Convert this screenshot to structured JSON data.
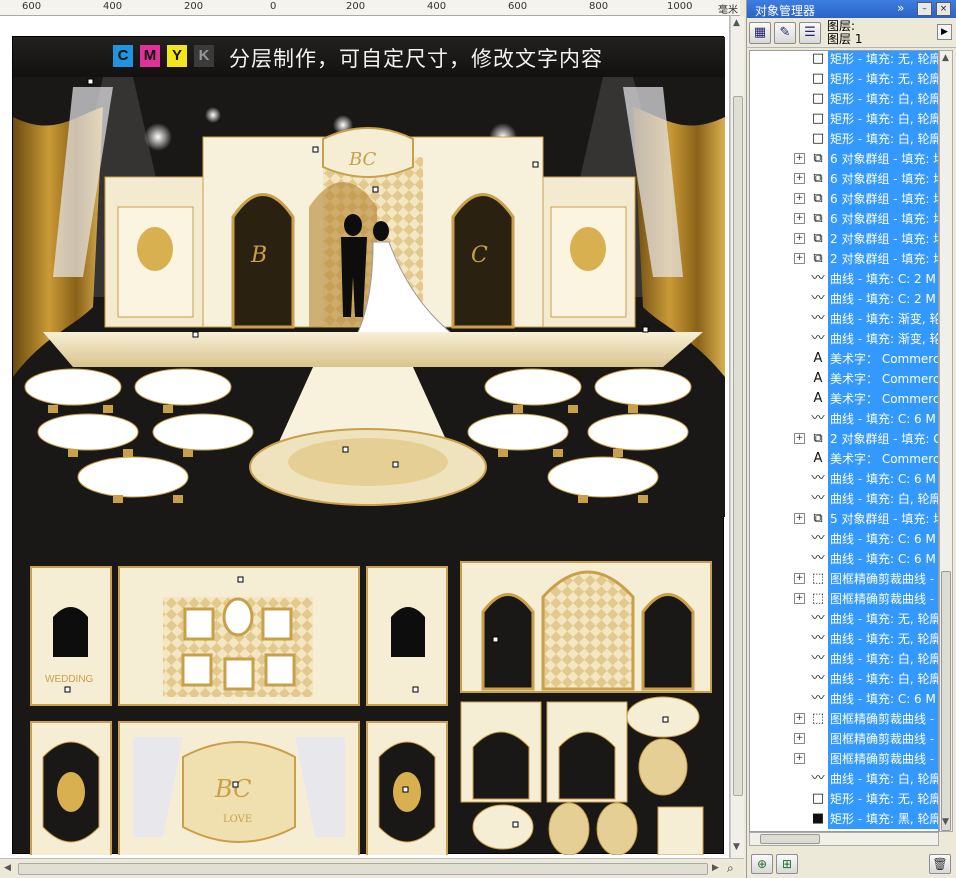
{
  "ruler": {
    "labels": [
      "600",
      "400",
      "200",
      "0",
      "200",
      "400",
      "600",
      "800",
      "1000"
    ],
    "unit": "毫米"
  },
  "canvas": {
    "cmyk_letters": [
      "C",
      "M",
      "Y",
      "K"
    ],
    "cmyk_colors": [
      "#1f95e0",
      "#e0309a",
      "#f2e51a",
      "#3a3a3a"
    ],
    "banner_title": "分层制作，可自定尺寸，修改文字内容",
    "monogram": "BC",
    "letter_left": "B",
    "letter_right": "C",
    "photo_wall_text": "WEDDING",
    "love_text": "LOVE",
    "accent_gold": "#c9a04a",
    "cream": "#f3ead0"
  },
  "panel": {
    "title": "对象管理器",
    "layer_label_line1": "图层:",
    "layer_label_line2": "图层 1",
    "objects": [
      {
        "icon": "rect-icon",
        "label": "矩形 - 填充: 无, 轮廓",
        "selected": true,
        "expand": false
      },
      {
        "icon": "rect-icon",
        "label": "矩形 - 填充: 无, 轮廓",
        "selected": true,
        "expand": false
      },
      {
        "icon": "rect-icon",
        "label": "矩形 - 填充: 白, 轮廓",
        "selected": true,
        "expand": false
      },
      {
        "icon": "rect-icon",
        "label": "矩形 - 填充: 白, 轮廓",
        "selected": true,
        "expand": false
      },
      {
        "icon": "rect-icon",
        "label": "矩形 - 填充: 白, 轮廓",
        "selected": true,
        "expand": false
      },
      {
        "icon": "group-icon",
        "label": "6 对象群组 - 填充: 均",
        "selected": true,
        "expand": true
      },
      {
        "icon": "group-icon",
        "label": "6 对象群组 - 填充: 均",
        "selected": true,
        "expand": true
      },
      {
        "icon": "group-icon",
        "label": "6 对象群组 - 填充: 均",
        "selected": true,
        "expand": true
      },
      {
        "icon": "group-icon",
        "label": "6 对象群组 - 填充: 均",
        "selected": true,
        "expand": true
      },
      {
        "icon": "group-icon",
        "label": "2 对象群组 - 填充: 均",
        "selected": true,
        "expand": true
      },
      {
        "icon": "group-icon",
        "label": "2 对象群组 - 填充: 均",
        "selected": true,
        "expand": true
      },
      {
        "icon": "curve-icon",
        "label": "曲线 - 填充: C: 2 M",
        "selected": true,
        "expand": false
      },
      {
        "icon": "curve-icon",
        "label": "曲线 - 填充: C: 2 M",
        "selected": true,
        "expand": false
      },
      {
        "icon": "curve-icon",
        "label": "曲线 - 填充: 渐变, 轮",
        "selected": true,
        "expand": false
      },
      {
        "icon": "curve-icon",
        "label": "曲线 - 填充: 渐变, 轮",
        "selected": true,
        "expand": false
      },
      {
        "icon": "artistic-text-icon",
        "label": "美术字： Commerc",
        "selected": true,
        "expand": false
      },
      {
        "icon": "artistic-text-icon",
        "label": "美术字： Commerc",
        "selected": true,
        "expand": false
      },
      {
        "icon": "artistic-text-icon",
        "label": "美术字： Commerc",
        "selected": true,
        "expand": false
      },
      {
        "icon": "curve-icon",
        "label": "曲线 - 填充: C: 6 M",
        "selected": true,
        "expand": false
      },
      {
        "icon": "group-icon",
        "label": "2 对象群组 - 填充: C",
        "selected": true,
        "expand": true
      },
      {
        "icon": "artistic-text-icon",
        "label": "美术字： Commerc",
        "selected": true,
        "expand": false
      },
      {
        "icon": "curve-icon",
        "label": "曲线 - 填充: C: 6 M",
        "selected": true,
        "expand": false
      },
      {
        "icon": "curve-icon",
        "label": "曲线 - 填充: 白, 轮廓",
        "selected": true,
        "expand": false
      },
      {
        "icon": "group-icon",
        "label": "5 对象群组 - 填充: 均",
        "selected": true,
        "expand": true
      },
      {
        "icon": "curve-icon",
        "label": "曲线 - 填充: C: 6 M",
        "selected": true,
        "expand": false
      },
      {
        "icon": "curve-icon",
        "label": "曲线 - 填充: C: 6 M",
        "selected": true,
        "expand": false
      },
      {
        "icon": "powerclip-icon",
        "label": "图框精确剪裁曲线 -",
        "selected": true,
        "expand": true
      },
      {
        "icon": "powerclip-icon",
        "label": "图框精确剪裁曲线 -",
        "selected": true,
        "expand": true
      },
      {
        "icon": "curve-icon",
        "label": "曲线 - 填充: 无, 轮廓",
        "selected": true,
        "expand": false
      },
      {
        "icon": "curve-icon",
        "label": "曲线 - 填充: 无, 轮廓",
        "selected": true,
        "expand": false
      },
      {
        "icon": "curve-icon",
        "label": "曲线 - 填充: 白, 轮廓",
        "selected": true,
        "expand": false
      },
      {
        "icon": "curve-icon",
        "label": "曲线 - 填充: 白, 轮廓",
        "selected": true,
        "expand": false
      },
      {
        "icon": "curve-icon",
        "label": "曲线 - 填充: C: 6 M",
        "selected": true,
        "expand": false
      },
      {
        "icon": "powerclip-icon",
        "label": "图框精确剪裁曲线 -",
        "selected": true,
        "expand": true
      },
      {
        "icon": "none",
        "label": "图框精确剪裁曲线 -",
        "selected": true,
        "expand": true
      },
      {
        "icon": "none",
        "label": "图框精确剪裁曲线 -",
        "selected": true,
        "expand": true
      },
      {
        "icon": "curve-icon",
        "label": "曲线 - 填充: 白, 轮廓",
        "selected": true,
        "expand": false
      },
      {
        "icon": "rect-icon",
        "label": "矩形 - 填充: 无, 轮廓",
        "selected": true,
        "expand": false
      },
      {
        "icon": "rect-black-icon",
        "label": "矩形 - 填充: 黑, 轮廓",
        "selected": true,
        "expand": false
      }
    ]
  }
}
